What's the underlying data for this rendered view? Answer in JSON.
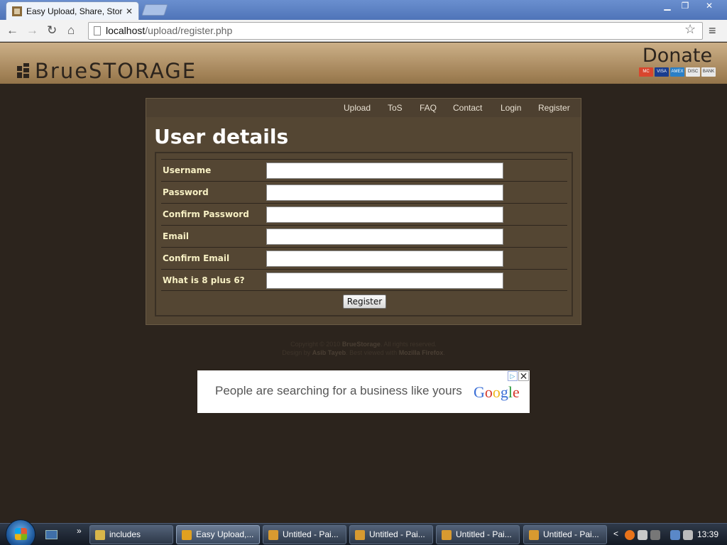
{
  "browser": {
    "tab_title": "Easy Upload, Share, Store",
    "tab_close": "✕",
    "url_host": "localhost",
    "url_path": "/upload/register.php",
    "window_buttons": {
      "minimize": "▁",
      "maximize": "❐",
      "close": "✕"
    }
  },
  "header": {
    "logo_text": "BrueSTORAGE",
    "donate_label": "Donate",
    "payment_cards": [
      {
        "label": "MC",
        "color": "#d9462e"
      },
      {
        "label": "VISA",
        "color": "#1a3d8f"
      },
      {
        "label": "AMEX",
        "color": "#2a7fc6"
      },
      {
        "label": "DISC",
        "color": "#e8e8e8"
      },
      {
        "label": "BANK",
        "color": "#e8e8e8"
      }
    ]
  },
  "nav": {
    "items": [
      "Upload",
      "ToS",
      "FAQ",
      "Contact",
      "Login",
      "Register"
    ]
  },
  "page": {
    "title": "User details"
  },
  "form": {
    "fields": [
      {
        "label": "Username",
        "value": ""
      },
      {
        "label": "Password",
        "value": ""
      },
      {
        "label": "Confirm Password",
        "value": ""
      },
      {
        "label": "Email",
        "value": ""
      },
      {
        "label": "Confirm Email",
        "value": ""
      },
      {
        "label": "What is 8 plus 6?",
        "value": ""
      }
    ],
    "submit_label": "Register"
  },
  "footer": {
    "line1_prefix": "Copyright © 2010 ",
    "line1_brand": "BrueStorage",
    "line1_suffix": ". All rights reserved.",
    "line2_prefix": "Design by ",
    "line2_author": "Asib Tayeb",
    "line2_middle": ". Best viewed with ",
    "line2_browser": "Mozilla Firefox",
    "line2_suffix": "."
  },
  "ad": {
    "text": "People are searching for a business like yours",
    "brand": "Google",
    "choices_icon": "▷",
    "close_icon": "✕"
  },
  "taskbar": {
    "tasks": [
      {
        "label": "includes",
        "icon_color": "#d8b64a",
        "active": false
      },
      {
        "label": "Easy Upload,...",
        "icon_color": "#e0a020",
        "active": true
      },
      {
        "label": "Untitled - Pai...",
        "icon_color": "#d89a30",
        "active": false
      },
      {
        "label": "Untitled - Pai...",
        "icon_color": "#d89a30",
        "active": false
      },
      {
        "label": "Untitled - Pai...",
        "icon_color": "#d89a30",
        "active": false
      },
      {
        "label": "Untitled - Pai...",
        "icon_color": "#d89a30",
        "active": false
      }
    ],
    "clock": "13:39"
  }
}
